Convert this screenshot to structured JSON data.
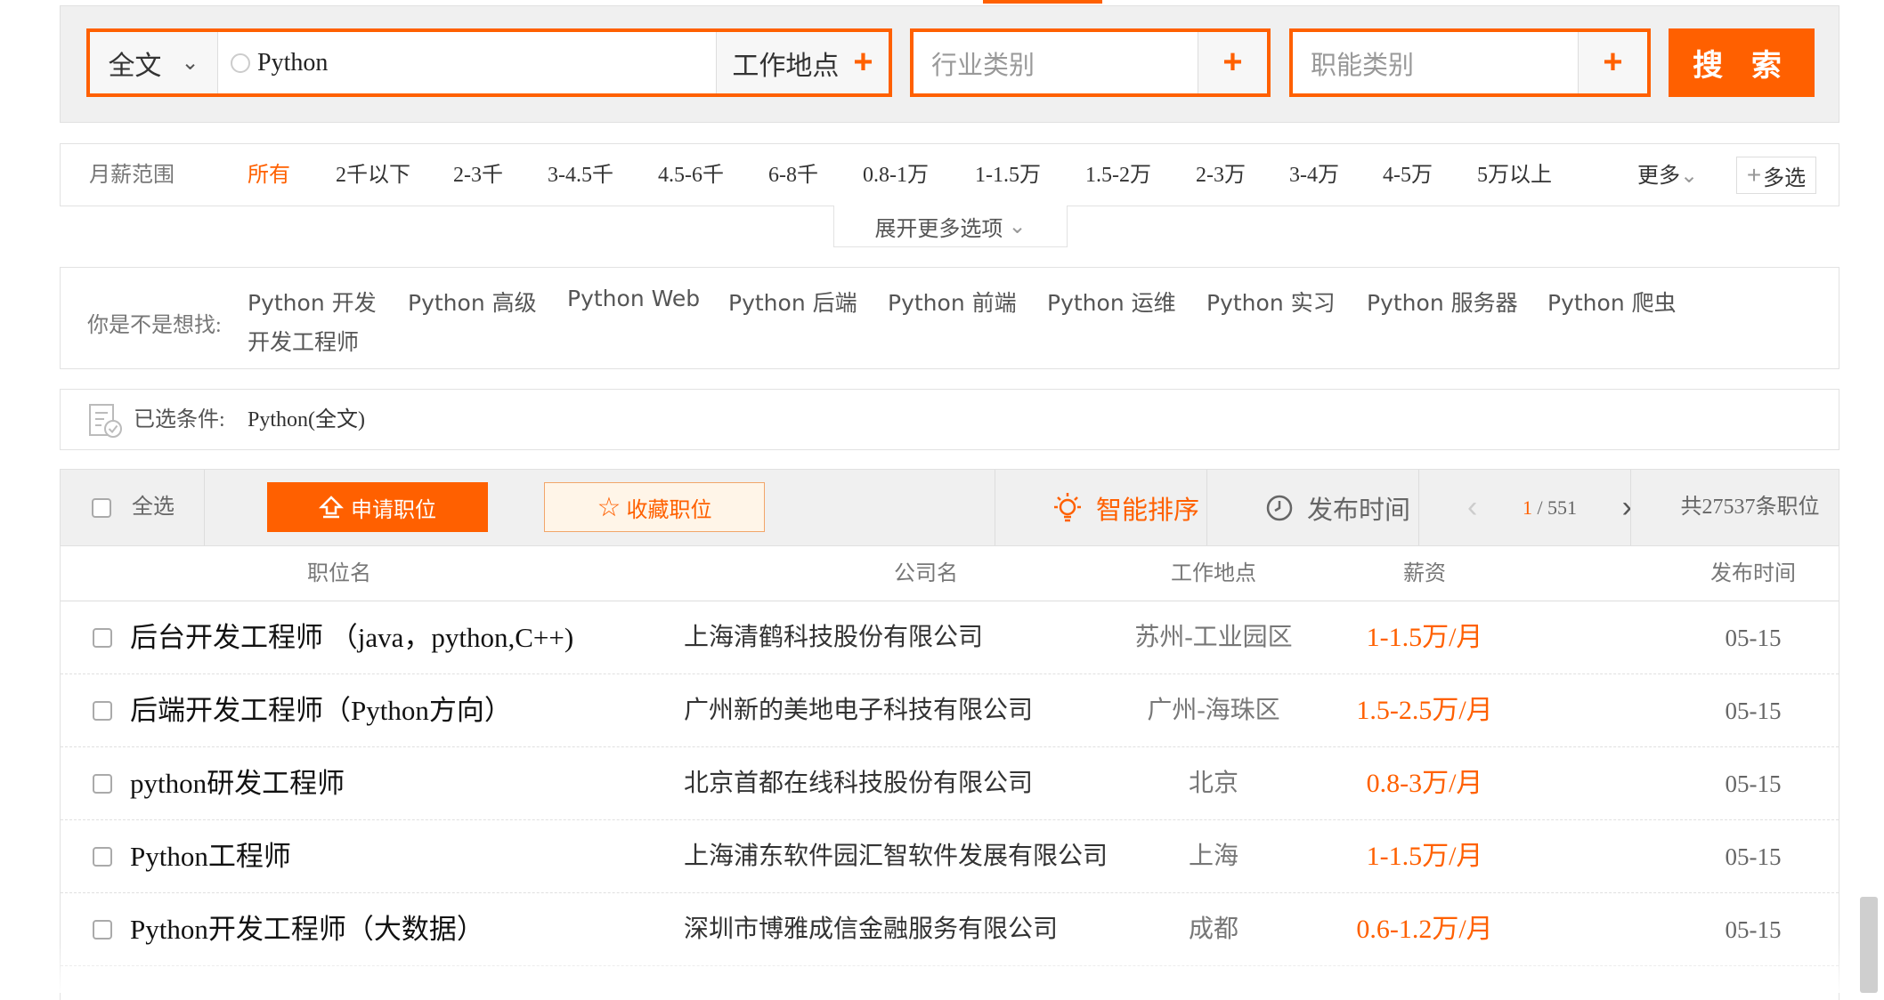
{
  "search": {
    "scope": "全文",
    "keyword": "Python",
    "location_label": "工作地点",
    "industry_placeholder": "行业类别",
    "function_placeholder": "职能类别",
    "button": "搜 索"
  },
  "salary_filter": {
    "label": "月薪范围",
    "options": [
      "所有",
      "2千以下",
      "2-3千",
      "3-4.5千",
      "4.5-6千",
      "6-8千",
      "0.8-1万",
      "1-1.5万",
      "1.5-2万",
      "2-3万",
      "3-4万",
      "4-5万",
      "5万以上"
    ],
    "selected": "所有",
    "more": "更多",
    "multi": "多选",
    "expand": "展开更多选项"
  },
  "suggestions": {
    "label": "你是不是想找:",
    "items": [
      "Python 开发",
      "Python 高级",
      "Python Web",
      "Python 后端",
      "Python 前端",
      "Python 运维",
      "Python 实习",
      "Python 服务器",
      "Python 爬虫",
      "开发工程师"
    ]
  },
  "conditions": {
    "label": "已选条件:",
    "value": "Python(全文)"
  },
  "toolbar": {
    "select_all": "全选",
    "apply": "申请职位",
    "favorite": "收藏职位",
    "smart_sort": "智能排序",
    "time_sort": "发布时间",
    "current_page": "1",
    "total_pages": "/ 551",
    "total": "共27537条职位"
  },
  "table": {
    "headers": [
      "职位名",
      "公司名",
      "工作地点",
      "薪资",
      "发布时间"
    ],
    "rows": [
      {
        "title": "后台开发工程师 （java，python,C++)",
        "company": "上海清鹤科技股份有限公司",
        "location": "苏州-工业园区",
        "salary": "1-1.5万/月",
        "date": "05-15"
      },
      {
        "title": "后端开发工程师（Python方向）",
        "company": "广州新的美地电子科技有限公司",
        "location": "广州-海珠区",
        "salary": "1.5-2.5万/月",
        "date": "05-15"
      },
      {
        "title": "python研发工程师",
        "company": "北京首都在线科技股份有限公司",
        "location": "北京",
        "salary": "0.8-3万/月",
        "date": "05-15"
      },
      {
        "title": "Python工程师",
        "company": "上海浦东软件园汇智软件发展有限公司",
        "location": "上海",
        "salary": "1-1.5万/月",
        "date": "05-15"
      },
      {
        "title": "Python开发工程师（大数据）",
        "company": "深圳市博雅成信金融服务有限公司",
        "location": "成都",
        "salary": "0.6-1.2万/月",
        "date": "05-15"
      }
    ]
  },
  "colors": {
    "accent": "#ff6000",
    "panel": "#f0f0f0"
  },
  "icons": [
    "search-icon",
    "chevron-down-icon",
    "plus-icon",
    "checklist-icon",
    "upload-icon",
    "star-icon",
    "bulb-icon",
    "clock-icon",
    "chevron-left-icon",
    "chevron-right-icon"
  ]
}
